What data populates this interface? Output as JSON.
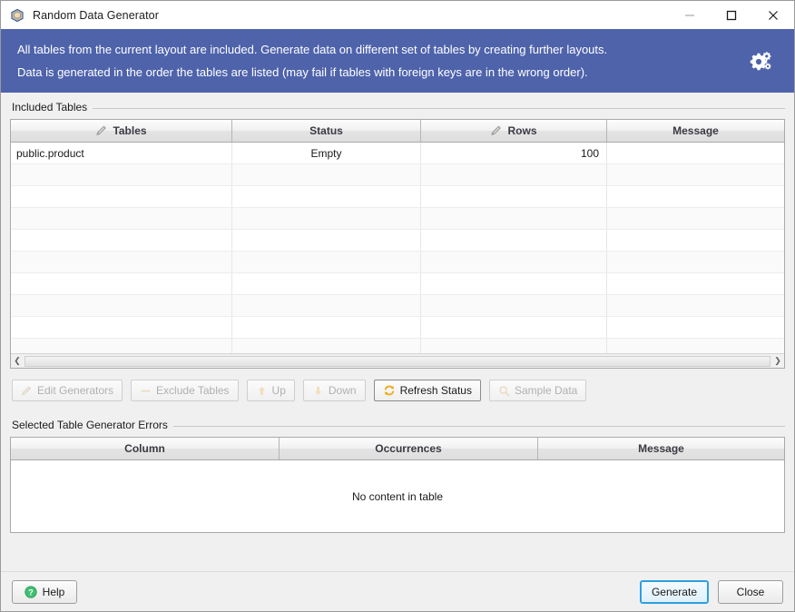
{
  "window": {
    "title": "Random Data Generator",
    "icon": "cube-icon",
    "controls": {
      "minimize": "minimize-icon",
      "maximize": "maximize-icon",
      "close": "close-icon"
    }
  },
  "banner": {
    "line1": "All tables from the current layout are included. Generate data on different set of tables by creating further layouts.",
    "line2": "Data is generated in the order the tables are listed (may fail if tables with foreign keys are in the wrong order).",
    "settings_icon": "gears-icon",
    "background_color": "#4f63ab",
    "text_color": "#ffffff"
  },
  "included_tables": {
    "group_label": "Included Tables",
    "columns": [
      {
        "label": "Tables",
        "icon": "pencil-icon",
        "align": "left"
      },
      {
        "label": "Status",
        "icon": null,
        "align": "center"
      },
      {
        "label": "Rows",
        "icon": "pencil-icon",
        "align": "right"
      },
      {
        "label": "Message",
        "icon": null,
        "align": "left"
      }
    ],
    "rows": [
      {
        "tables": "public.product",
        "status": "Empty",
        "rows": "100",
        "message": ""
      }
    ],
    "empty_row_count": 9,
    "scrollbar": {
      "left_arrow": "chevron-left-icon",
      "right_arrow": "chevron-right-icon"
    }
  },
  "toolbar": {
    "buttons": [
      {
        "label": "Edit Generators",
        "icon": "pencil-icon",
        "enabled": false
      },
      {
        "label": "Exclude Tables",
        "icon": "minus-icon",
        "enabled": false
      },
      {
        "label": "Up",
        "icon": "arrow-up-icon",
        "enabled": false
      },
      {
        "label": "Down",
        "icon": "arrow-down-icon",
        "enabled": false
      },
      {
        "label": "Refresh Status",
        "icon": "refresh-icon",
        "enabled": true
      },
      {
        "label": "Sample Data",
        "icon": "search-icon",
        "enabled": false
      }
    ]
  },
  "generator_errors": {
    "group_label": "Selected Table Generator Errors",
    "columns": [
      {
        "label": "Column"
      },
      {
        "label": "Occurrences"
      },
      {
        "label": "Message"
      }
    ],
    "empty_message": "No content in table"
  },
  "footer": {
    "help_label": "Help",
    "help_icon": "help-question-icon",
    "generate_label": "Generate",
    "close_label": "Close",
    "accent_color": "#2e9fe0"
  }
}
